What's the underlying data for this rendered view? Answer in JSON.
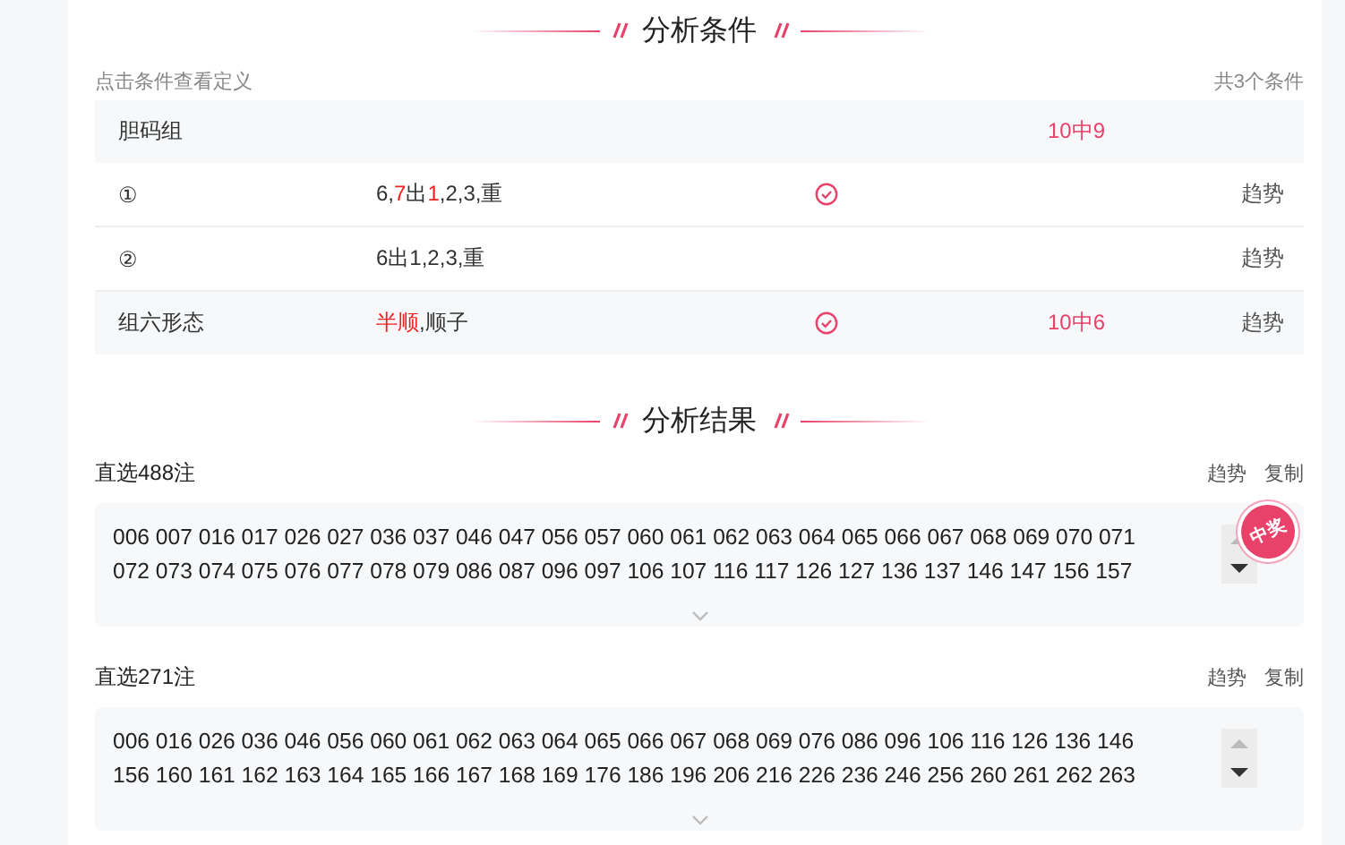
{
  "condition_section": {
    "title": "分析条件",
    "hint": "点击条件查看定义",
    "count": "共3个条件"
  },
  "conditions": [
    {
      "name": "胆码组",
      "result": "10中9",
      "children": [
        {
          "name": "①",
          "value": [
            {
              "text": "6,",
              "highlight": false
            },
            {
              "text": "7",
              "highlight": true
            },
            {
              "text": "出",
              "highlight": false
            },
            {
              "text": "1",
              "highlight": true
            },
            {
              "text": ",2,3,重",
              "highlight": false
            }
          ],
          "matched": true,
          "trend": "趋势"
        },
        {
          "name": "②",
          "value": [
            {
              "text": "6出1,2,3,重",
              "highlight": false
            }
          ],
          "matched": false,
          "trend": "趋势"
        }
      ]
    },
    {
      "name": "组六形态",
      "value": [
        {
          "text": "半顺",
          "highlight": true
        },
        {
          "text": ",顺子",
          "highlight": false
        }
      ],
      "matched": true,
      "result": "10中6",
      "trend": "趋势"
    }
  ],
  "result_section": {
    "title": "分析结果"
  },
  "results": [
    {
      "title": "直选488注",
      "actions": [
        "趋势",
        "复制"
      ],
      "stamp": "中奖",
      "lines": [
        "006 007 016 017 026 027 036 037 046 047 056 057 060 061 062 063 064 065 066 067 068 069 070 071",
        "072 073 074 075 076 077 078 079 086 087 096 097 106 107 116 117 126 127 136 137 146 147 156 157"
      ]
    },
    {
      "title": "直选271注",
      "actions": [
        "趋势",
        "复制"
      ],
      "lines": [
        "006 016 026 036 046 056 060 061 062 063 064 065 066 067 068 069 076 086 096 106 116 126 136 146",
        "156 160 161 162 163 164 165 166 167 168 169 176 186 196 206 216 226 236 246 256 260 261 262 263"
      ]
    }
  ]
}
